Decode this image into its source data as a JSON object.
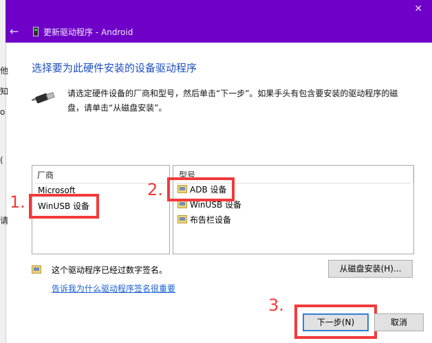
{
  "window": {
    "title": "更新驱动程序 - Android",
    "close_glyph": "✕",
    "back_glyph": "←",
    "background_fragments": [
      "他",
      "知",
      "o",
      "(",
      "请"
    ]
  },
  "main": {
    "heading": "选择要为此硬件安装的设备驱动程序",
    "instruction": "请选定硬件设备的厂商和型号，然后单击“下一步”。如果手头有包含要安装的驱动程序的磁盘，请单击“从磁盘安装”。"
  },
  "manufacturer_list": {
    "header": "厂商",
    "items": [
      "Microsoft",
      "WinUSB 设备"
    ]
  },
  "model_list": {
    "header": "型号",
    "items": [
      "ADB 设备",
      "WinUSB 设备",
      "布告栏设备"
    ]
  },
  "signature": {
    "text": "这个驱动程序已经过数字签名。",
    "link": "告诉我为什么驱动程序签名很重要"
  },
  "buttons": {
    "have_disk": "从磁盘安装(H)...",
    "next": "下一步(N)",
    "cancel": "取消"
  },
  "annotations": {
    "step1": "1.",
    "step2": "2.",
    "step3": "3.",
    "color": "#f23a3a"
  },
  "colors": {
    "titlebar": "#6f00c8",
    "heading": "#1b4fbf",
    "link": "#1a5fd0"
  }
}
